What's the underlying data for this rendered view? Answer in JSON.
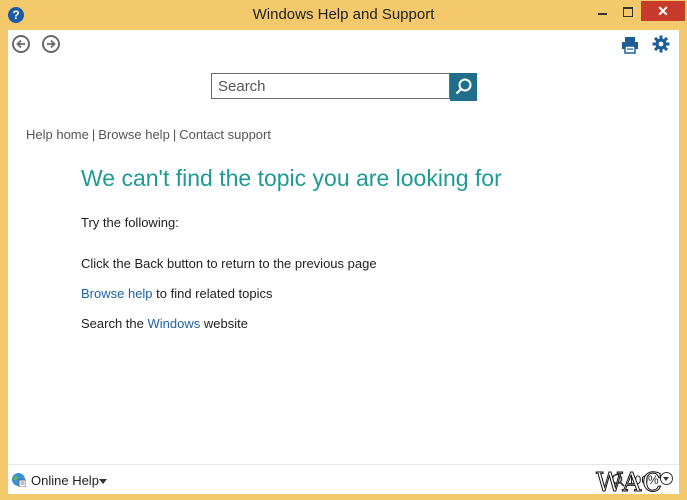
{
  "window": {
    "title": "Windows Help and Support",
    "help_glyph": "?",
    "close_glyph": "✕",
    "accent_color": "#f3c96b",
    "close_color": "#c7392a"
  },
  "toolbar": {
    "back_icon": "back-arrow-icon",
    "forward_icon": "forward-arrow-icon",
    "print_icon": "print-icon",
    "settings_icon": "gear-icon"
  },
  "search": {
    "placeholder": "Search",
    "button_icon": "search-icon",
    "button_color": "#1f6f8b"
  },
  "breadcrumb": {
    "items": [
      "Help home",
      "Browse help",
      "Contact support"
    ],
    "separator": "|"
  },
  "main": {
    "heading": "We can't find the topic you are looking for",
    "heading_color": "#1e9a94",
    "try_text": "Try the following:",
    "back_text": "Click the Back button to return to the previous page",
    "browse_link": "Browse help",
    "browse_rest": " to find related topics",
    "search_prefix": "Search the ",
    "windows_link": "Windows",
    "search_suffix": " website",
    "link_color": "#1d62a8"
  },
  "statusbar": {
    "online_label": "Online Help",
    "zoom_value": "100%"
  },
  "watermark": {
    "text": "WAC"
  }
}
